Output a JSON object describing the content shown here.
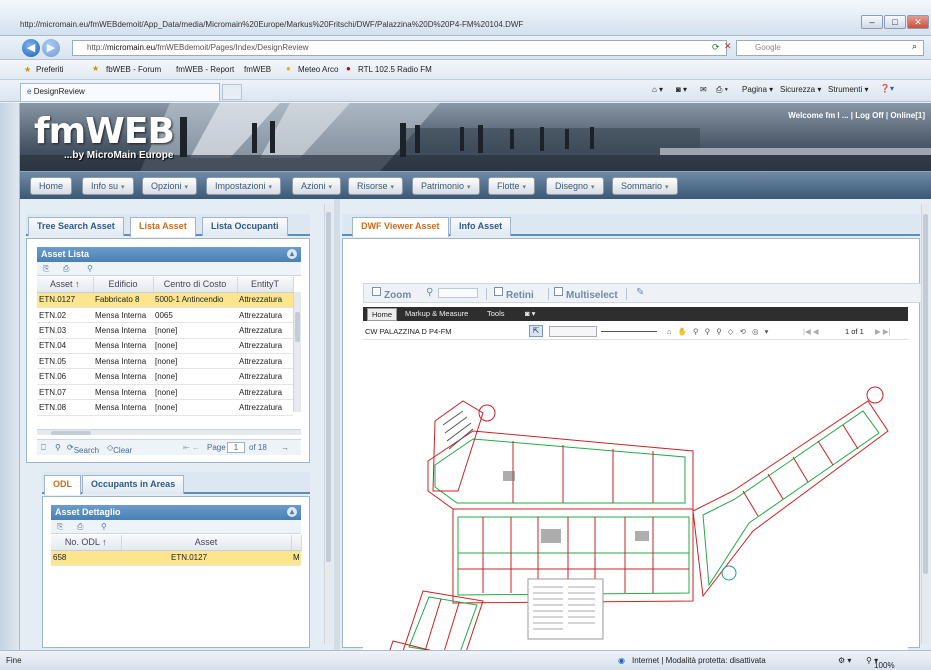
{
  "browser": {
    "title": "http://micromain.eu/fmWEBdemoit/App_Data/media/Micromain%20Europe/Markus%20Fritschi/DWF/Palazzina%20D%20P4-FM%20104.DWF",
    "title_buttons": [
      "–",
      "□",
      "✕"
    ],
    "url_prefix": "http://",
    "url_host": "micromain.eu",
    "url_path": "/fmWEBdemoit/Pages/Index/DesignReview",
    "search_placeholder": "Google",
    "favorites_label": "Preferiti",
    "favorites": [
      "fbWEB - Forum",
      "fmWEB - Report",
      "fmWEB",
      "Meteo Arco",
      "RTL 102.5 Radio FM"
    ],
    "active_tab": "DesignReview",
    "command_bar": [
      "Pagina ▾",
      "Sicurezza ▾",
      "Strumenti ▾"
    ],
    "status_left": "Fine",
    "status_zone": "Internet | Modalità protetta: disattivata",
    "zoom_level": "100%"
  },
  "app": {
    "logo": "fmWEB",
    "logo_sub": "...by MicroMain Europe",
    "welcome": "Welcome fm I ... | Log Off | Online[1]",
    "menu": [
      "Home",
      "Info su",
      "Opzioni",
      "Impostazioni",
      "Azioni",
      "Risorse",
      "Patrimonio",
      "Flotte",
      "Disegno",
      "Sommario"
    ]
  },
  "left_tabs": [
    "Tree Search Asset",
    "Lista Asset",
    "Lista Occupanti"
  ],
  "asset_list": {
    "header": "Asset Lista",
    "columns": [
      "Asset ↑",
      "Edificio",
      "Centro di Costo",
      "EntityT"
    ],
    "rows": [
      [
        "ETN.0127",
        "Fabbricato 8",
        "5000-1 Antincendio",
        "Attrezzatura"
      ],
      [
        "ETN.02",
        "Mensa Interna",
        "0065",
        "Attrezzatura"
      ],
      [
        "ETN.03",
        "Mensa Interna",
        "[none]",
        "Attrezzatura"
      ],
      [
        "ETN.04",
        "Mensa Interna",
        "[none]",
        "Attrezzatura"
      ],
      [
        "ETN.05",
        "Mensa Interna",
        "[none]",
        "Attrezzatura"
      ],
      [
        "ETN.06",
        "Mensa Interna",
        "[none]",
        "Attrezzatura"
      ],
      [
        "ETN.07",
        "Mensa Interna",
        "[none]",
        "Attrezzatura"
      ],
      [
        "ETN.08",
        "Mensa Interna",
        "[none]",
        "Attrezzatura"
      ]
    ],
    "pager_search": "Search",
    "pager_clear": "Clear",
    "pager_page": "Page",
    "pager_current": "1",
    "pager_of": "of 18"
  },
  "detail_tabs": [
    "ODL",
    "Occupants in Areas"
  ],
  "asset_detail": {
    "header": "Asset Dettaglio",
    "columns": [
      "No. ODL ↑",
      "Asset",
      ""
    ],
    "rows": [
      [
        "658",
        "ETN.0127",
        "M"
      ]
    ]
  },
  "right_tabs": [
    "DWF Viewer Asset",
    "Info Asset"
  ],
  "viewer": {
    "tools": [
      "Zoom",
      "Retini",
      "Multiselect"
    ],
    "dark_tabs": [
      "Home",
      "Markup & Measure",
      "Tools"
    ],
    "sheet_name": "CW PALAZZINA D P4-FM",
    "page_indicator": "1 of 1"
  }
}
